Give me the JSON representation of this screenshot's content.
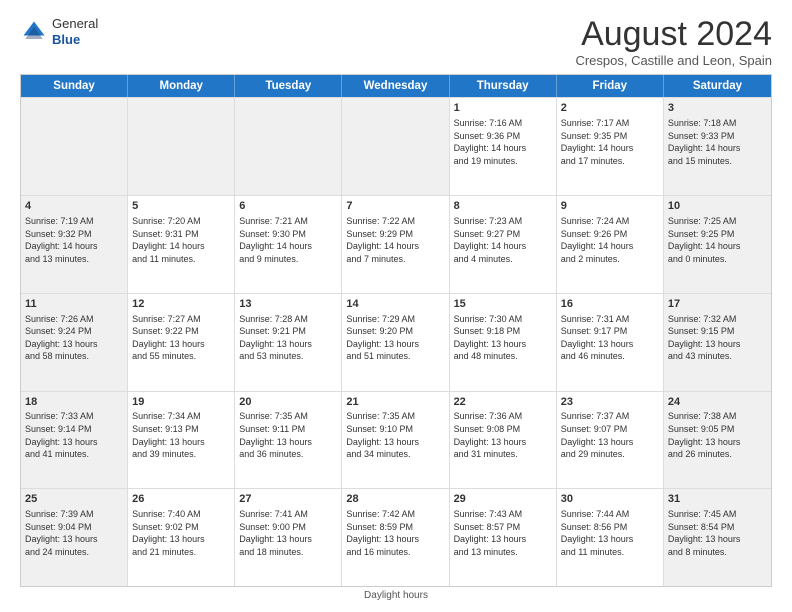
{
  "header": {
    "logo_general": "General",
    "logo_blue": "Blue",
    "month_year": "August 2024",
    "location": "Crespos, Castille and Leon, Spain"
  },
  "footer": {
    "note": "Daylight hours"
  },
  "days_of_week": [
    "Sunday",
    "Monday",
    "Tuesday",
    "Wednesday",
    "Thursday",
    "Friday",
    "Saturday"
  ],
  "weeks": [
    [
      {
        "day": "",
        "detail": "",
        "shaded": true
      },
      {
        "day": "",
        "detail": "",
        "shaded": true
      },
      {
        "day": "",
        "detail": "",
        "shaded": true
      },
      {
        "day": "",
        "detail": "",
        "shaded": true
      },
      {
        "day": "1",
        "detail": "Sunrise: 7:16 AM\nSunset: 9:36 PM\nDaylight: 14 hours\nand 19 minutes.",
        "shaded": false
      },
      {
        "day": "2",
        "detail": "Sunrise: 7:17 AM\nSunset: 9:35 PM\nDaylight: 14 hours\nand 17 minutes.",
        "shaded": false
      },
      {
        "day": "3",
        "detail": "Sunrise: 7:18 AM\nSunset: 9:33 PM\nDaylight: 14 hours\nand 15 minutes.",
        "shaded": true
      }
    ],
    [
      {
        "day": "4",
        "detail": "Sunrise: 7:19 AM\nSunset: 9:32 PM\nDaylight: 14 hours\nand 13 minutes.",
        "shaded": true
      },
      {
        "day": "5",
        "detail": "Sunrise: 7:20 AM\nSunset: 9:31 PM\nDaylight: 14 hours\nand 11 minutes.",
        "shaded": false
      },
      {
        "day": "6",
        "detail": "Sunrise: 7:21 AM\nSunset: 9:30 PM\nDaylight: 14 hours\nand 9 minutes.",
        "shaded": false
      },
      {
        "day": "7",
        "detail": "Sunrise: 7:22 AM\nSunset: 9:29 PM\nDaylight: 14 hours\nand 7 minutes.",
        "shaded": false
      },
      {
        "day": "8",
        "detail": "Sunrise: 7:23 AM\nSunset: 9:27 PM\nDaylight: 14 hours\nand 4 minutes.",
        "shaded": false
      },
      {
        "day": "9",
        "detail": "Sunrise: 7:24 AM\nSunset: 9:26 PM\nDaylight: 14 hours\nand 2 minutes.",
        "shaded": false
      },
      {
        "day": "10",
        "detail": "Sunrise: 7:25 AM\nSunset: 9:25 PM\nDaylight: 14 hours\nand 0 minutes.",
        "shaded": true
      }
    ],
    [
      {
        "day": "11",
        "detail": "Sunrise: 7:26 AM\nSunset: 9:24 PM\nDaylight: 13 hours\nand 58 minutes.",
        "shaded": true
      },
      {
        "day": "12",
        "detail": "Sunrise: 7:27 AM\nSunset: 9:22 PM\nDaylight: 13 hours\nand 55 minutes.",
        "shaded": false
      },
      {
        "day": "13",
        "detail": "Sunrise: 7:28 AM\nSunset: 9:21 PM\nDaylight: 13 hours\nand 53 minutes.",
        "shaded": false
      },
      {
        "day": "14",
        "detail": "Sunrise: 7:29 AM\nSunset: 9:20 PM\nDaylight: 13 hours\nand 51 minutes.",
        "shaded": false
      },
      {
        "day": "15",
        "detail": "Sunrise: 7:30 AM\nSunset: 9:18 PM\nDaylight: 13 hours\nand 48 minutes.",
        "shaded": false
      },
      {
        "day": "16",
        "detail": "Sunrise: 7:31 AM\nSunset: 9:17 PM\nDaylight: 13 hours\nand 46 minutes.",
        "shaded": false
      },
      {
        "day": "17",
        "detail": "Sunrise: 7:32 AM\nSunset: 9:15 PM\nDaylight: 13 hours\nand 43 minutes.",
        "shaded": true
      }
    ],
    [
      {
        "day": "18",
        "detail": "Sunrise: 7:33 AM\nSunset: 9:14 PM\nDaylight: 13 hours\nand 41 minutes.",
        "shaded": true
      },
      {
        "day": "19",
        "detail": "Sunrise: 7:34 AM\nSunset: 9:13 PM\nDaylight: 13 hours\nand 39 minutes.",
        "shaded": false
      },
      {
        "day": "20",
        "detail": "Sunrise: 7:35 AM\nSunset: 9:11 PM\nDaylight: 13 hours\nand 36 minutes.",
        "shaded": false
      },
      {
        "day": "21",
        "detail": "Sunrise: 7:35 AM\nSunset: 9:10 PM\nDaylight: 13 hours\nand 34 minutes.",
        "shaded": false
      },
      {
        "day": "22",
        "detail": "Sunrise: 7:36 AM\nSunset: 9:08 PM\nDaylight: 13 hours\nand 31 minutes.",
        "shaded": false
      },
      {
        "day": "23",
        "detail": "Sunrise: 7:37 AM\nSunset: 9:07 PM\nDaylight: 13 hours\nand 29 minutes.",
        "shaded": false
      },
      {
        "day": "24",
        "detail": "Sunrise: 7:38 AM\nSunset: 9:05 PM\nDaylight: 13 hours\nand 26 minutes.",
        "shaded": true
      }
    ],
    [
      {
        "day": "25",
        "detail": "Sunrise: 7:39 AM\nSunset: 9:04 PM\nDaylight: 13 hours\nand 24 minutes.",
        "shaded": true
      },
      {
        "day": "26",
        "detail": "Sunrise: 7:40 AM\nSunset: 9:02 PM\nDaylight: 13 hours\nand 21 minutes.",
        "shaded": false
      },
      {
        "day": "27",
        "detail": "Sunrise: 7:41 AM\nSunset: 9:00 PM\nDaylight: 13 hours\nand 18 minutes.",
        "shaded": false
      },
      {
        "day": "28",
        "detail": "Sunrise: 7:42 AM\nSunset: 8:59 PM\nDaylight: 13 hours\nand 16 minutes.",
        "shaded": false
      },
      {
        "day": "29",
        "detail": "Sunrise: 7:43 AM\nSunset: 8:57 PM\nDaylight: 13 hours\nand 13 minutes.",
        "shaded": false
      },
      {
        "day": "30",
        "detail": "Sunrise: 7:44 AM\nSunset: 8:56 PM\nDaylight: 13 hours\nand 11 minutes.",
        "shaded": false
      },
      {
        "day": "31",
        "detail": "Sunrise: 7:45 AM\nSunset: 8:54 PM\nDaylight: 13 hours\nand 8 minutes.",
        "shaded": true
      }
    ]
  ]
}
